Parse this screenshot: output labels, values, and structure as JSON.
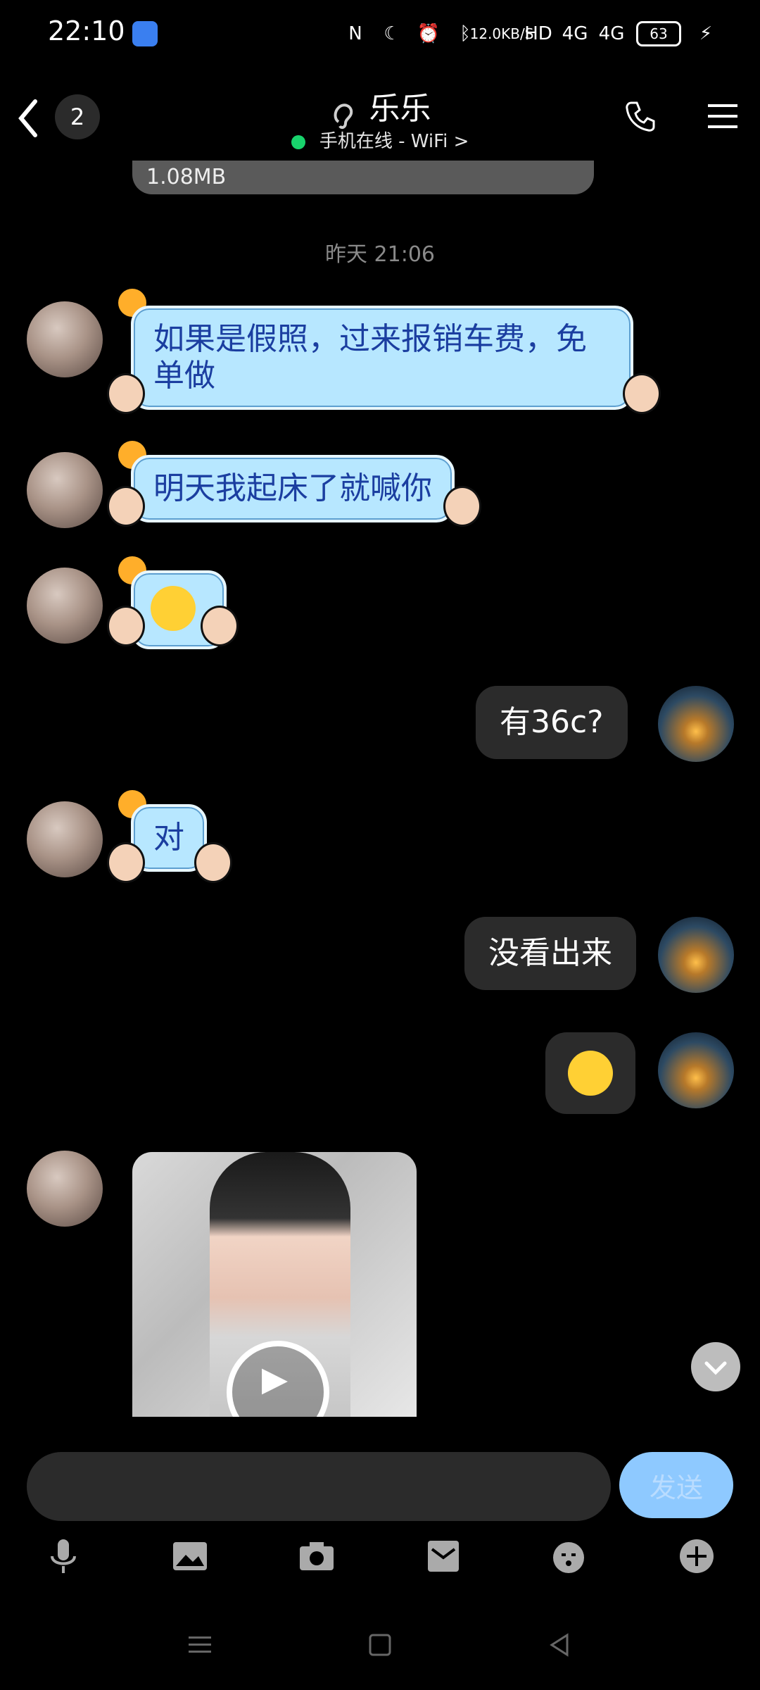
{
  "status_bar": {
    "time": "22:10",
    "net_speed": "12.0",
    "net_unit": "KB/S",
    "hd": "HD",
    "net1": "4G",
    "net2": "4G",
    "battery": "63"
  },
  "header": {
    "unread_count": "2",
    "contact_name": "乐乐",
    "online_status": "手机在线 - WiFi >"
  },
  "conversation": {
    "partial_text": "1.08MB",
    "timestamp": "昨天 21:06",
    "messages": [
      {
        "side": "left",
        "text": "如果是假照，过来报销车费，免单做"
      },
      {
        "side": "left",
        "text": "明天我起床了就喊你"
      },
      {
        "side": "left",
        "text": "",
        "emoji": "blush-face"
      },
      {
        "side": "right",
        "text": "有36c?"
      },
      {
        "side": "left",
        "text": "对"
      },
      {
        "side": "right",
        "text": "没看出来"
      },
      {
        "side": "right",
        "text": "",
        "emoji": "sweat-face"
      },
      {
        "side": "left",
        "type": "video"
      }
    ]
  },
  "composer": {
    "input_value": "",
    "send_label": "发送"
  },
  "toolbar": {
    "icons": [
      "microphone-icon",
      "image-icon",
      "camera-icon",
      "envelope-icon",
      "emoji-icon",
      "plus-icon"
    ]
  },
  "colors": {
    "background": "#000000",
    "bubble_blue": "#b7e7ff",
    "bubble_dark": "#2b2b2b",
    "send_button": "#8ec9ff",
    "online_dot": "#18d36c"
  }
}
